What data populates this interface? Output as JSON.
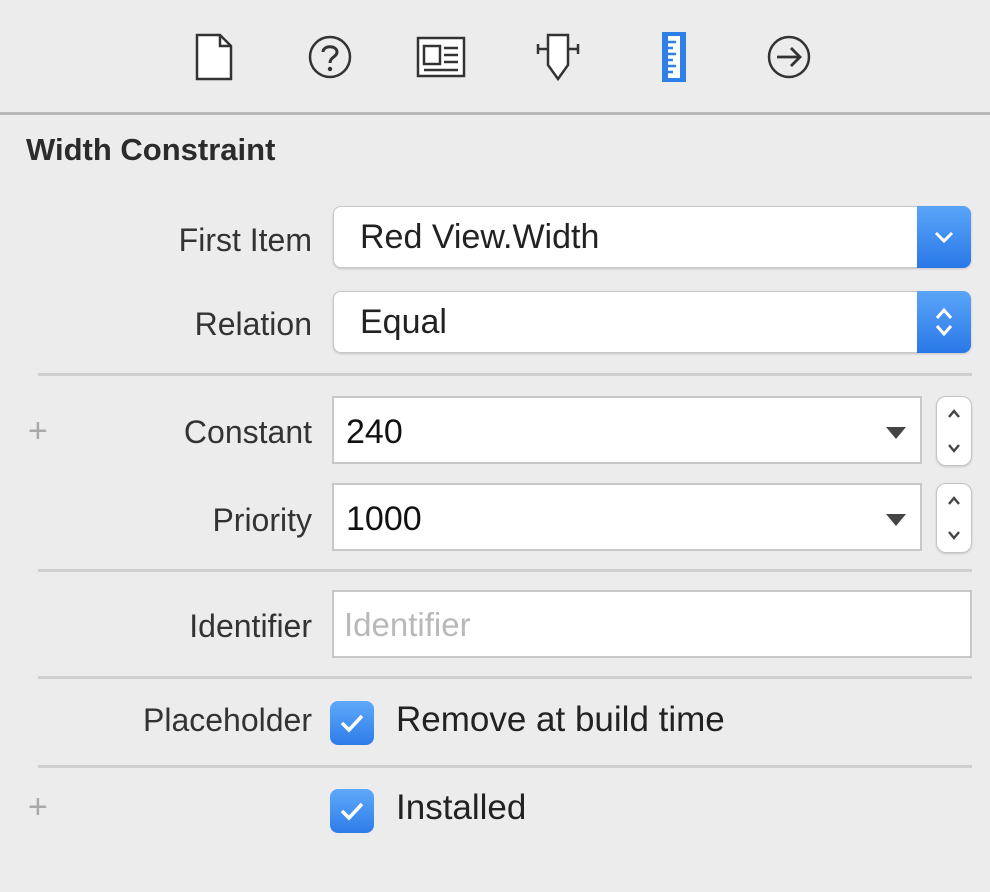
{
  "toolbar": {
    "icons": [
      "file-icon",
      "help-icon",
      "identity-icon",
      "attributes-icon",
      "size-ruler-icon",
      "connections-icon"
    ],
    "active_icon": "size-ruler-icon",
    "accent_color": "#2f7fe8"
  },
  "section": {
    "title": "Width Constraint"
  },
  "first_item": {
    "label": "First Item",
    "value": "Red View.Width"
  },
  "relation": {
    "label": "Relation",
    "value": "Equal"
  },
  "constant": {
    "label": "Constant",
    "value": "240"
  },
  "priority": {
    "label": "Priority",
    "value": "1000"
  },
  "identifier": {
    "label": "Identifier",
    "value": "",
    "placeholder": "Identifier"
  },
  "placeholder": {
    "label": "Placeholder",
    "checked": true,
    "checkbox_label": "Remove at build time"
  },
  "installed": {
    "checked": true,
    "checkbox_label": "Installed"
  },
  "plus_glyph": "+"
}
